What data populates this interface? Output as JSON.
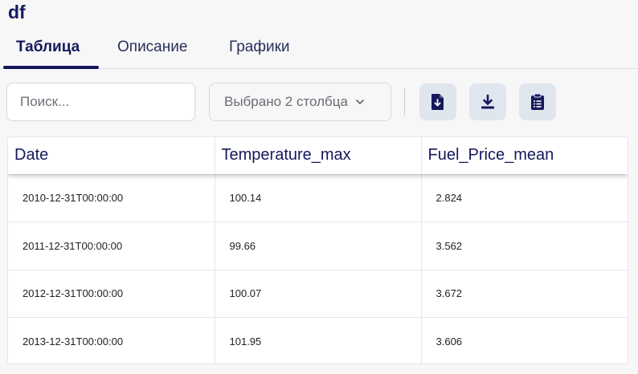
{
  "app": {
    "title": "df"
  },
  "tabs": [
    {
      "label": "Таблица",
      "active": true
    },
    {
      "label": "Описание",
      "active": false
    },
    {
      "label": "Графики",
      "active": false
    }
  ],
  "toolbar": {
    "search_placeholder": "Поиск...",
    "column_select_label": "Выбрано 2 столбца",
    "icons": [
      "file-download-icon",
      "download-icon",
      "clipboard-list-icon"
    ]
  },
  "colors": {
    "primary": "#15195c",
    "icon_button_bg": "#dfe6ee",
    "border": "#e2e7ee"
  },
  "table": {
    "columns": [
      "Date",
      "Temperature_max",
      "Fuel_Price_mean"
    ],
    "rows": [
      [
        "2010-12-31T00:00:00",
        "100.14",
        "2.824"
      ],
      [
        "2011-12-31T00:00:00",
        "99.66",
        "3.562"
      ],
      [
        "2012-12-31T00:00:00",
        "100.07",
        "3.672"
      ],
      [
        "2013-12-31T00:00:00",
        "101.95",
        "3.606"
      ]
    ]
  }
}
